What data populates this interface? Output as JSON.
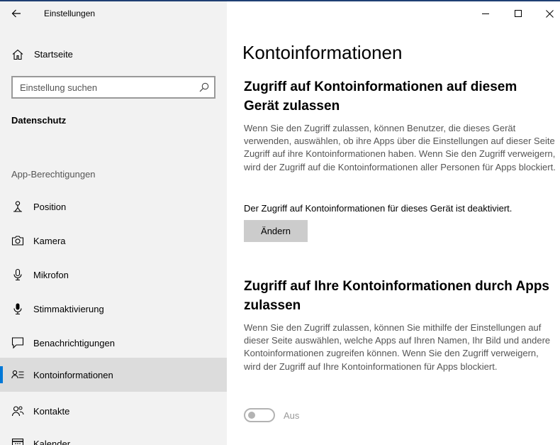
{
  "window": {
    "title": "Einstellungen",
    "controls": {
      "minimize": "minimize-icon",
      "maximize": "maximize-icon",
      "close": "close-icon"
    }
  },
  "sidebar": {
    "home_label": "Startseite",
    "search_placeholder": "Einstellung suchen",
    "section_title": "Datenschutz",
    "group_title": "App-Berechtigungen",
    "items": [
      {
        "label": "Position",
        "icon": "location-icon",
        "active": false
      },
      {
        "label": "Kamera",
        "icon": "camera-icon",
        "active": false
      },
      {
        "label": "Mikrofon",
        "icon": "microphone-icon",
        "active": false
      },
      {
        "label": "Stimmaktivierung",
        "icon": "voice-activation-icon",
        "active": false
      },
      {
        "label": "Benachrichtigungen",
        "icon": "notifications-icon",
        "active": false
      },
      {
        "label": "Kontoinformationen",
        "icon": "account-info-icon",
        "active": true
      },
      {
        "label": "Kontakte",
        "icon": "contacts-icon",
        "active": false
      },
      {
        "label": "Kalender",
        "icon": "calendar-icon",
        "active": false
      }
    ]
  },
  "main": {
    "page_title": "Kontoinformationen",
    "section1": {
      "heading": "Zugriff auf Kontoinformationen auf diesem Gerät zulassen",
      "description": "Wenn Sie den Zugriff zulassen, können Benutzer, die dieses Gerät verwenden, auswählen, ob ihre Apps über die Einstellungen auf dieser Seite Zugriff auf ihre Kontoinformationen haben. Wenn Sie den Zugriff verweigern, wird der Zugriff auf die Kontoinformationen aller Personen für Apps blockiert.",
      "status": "Der Zugriff auf Kontoinformationen für dieses Gerät ist deaktiviert.",
      "button_label": "Ändern"
    },
    "section2": {
      "heading": "Zugriff auf Ihre Kontoinformationen durch Apps zulassen",
      "description": "Wenn Sie den Zugriff zulassen, können Sie mithilfe der Einstellungen auf dieser Seite auswählen, welche Apps auf Ihren Namen, Ihr Bild und andere Kontoinformationen zugreifen können. Wenn Sie den Zugriff verweigern, wird der Zugriff auf Ihre Kontoinformationen für Apps blockiert.",
      "toggle_state": "Aus"
    }
  },
  "colors": {
    "accent": "#0078d7",
    "sidebar_bg": "#f2f2f2",
    "active_item_bg": "#dcdcdc",
    "button_bg": "#cccccc"
  }
}
